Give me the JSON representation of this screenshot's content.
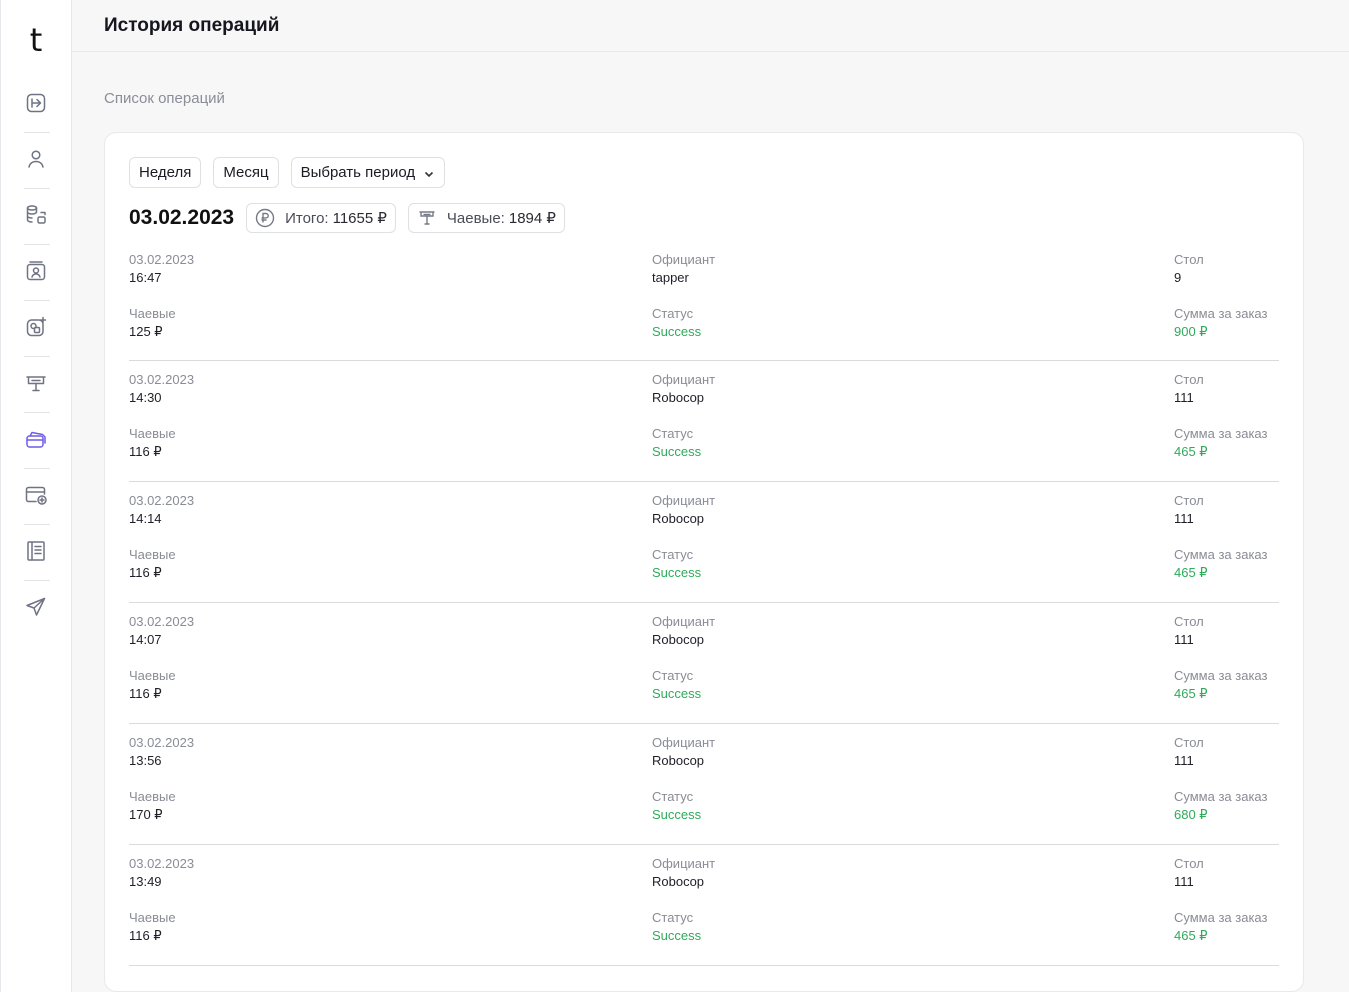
{
  "app": {
    "logo": "t"
  },
  "sidebar": {
    "items": [
      {
        "icon": "login-icon",
        "active": false
      },
      {
        "icon": "user-icon",
        "active": false
      },
      {
        "icon": "database-icon",
        "active": false
      },
      {
        "icon": "profile-card-icon",
        "active": false
      },
      {
        "icon": "widgets-icon",
        "active": false
      },
      {
        "icon": "presentation-icon",
        "active": false
      },
      {
        "icon": "cards-icon",
        "active": true
      },
      {
        "icon": "card-add-icon",
        "active": false
      },
      {
        "icon": "notebook-icon",
        "active": false
      },
      {
        "icon": "send-icon",
        "active": false
      }
    ]
  },
  "header": {
    "title": "История операций"
  },
  "main": {
    "section_label": "Список операций",
    "filters": {
      "week": "Неделя",
      "month": "Месяц",
      "period": "Выбрать период"
    },
    "summary": {
      "date": "03.02.2023",
      "total_label": "Итого:",
      "total_value": "11655 ₽",
      "tips_label": "Чаевые:",
      "tips_value": "1894 ₽"
    },
    "labels": {
      "waiter": "Официант",
      "table": "Стол",
      "tips": "Чаевые",
      "status": "Статус",
      "order_sum": "Сумма за заказ"
    },
    "operations": [
      {
        "date": "03.02.2023",
        "time": "16:47",
        "waiter": "tapper",
        "table": "9",
        "tips": "125 ₽",
        "status": "Success",
        "sum": "900 ₽"
      },
      {
        "date": "03.02.2023",
        "time": "14:30",
        "waiter": "Robocop",
        "table": "111",
        "tips": "116 ₽",
        "status": "Success",
        "sum": "465 ₽"
      },
      {
        "date": "03.02.2023",
        "time": "14:14",
        "waiter": "Robocop",
        "table": "111",
        "tips": "116 ₽",
        "status": "Success",
        "sum": "465 ₽"
      },
      {
        "date": "03.02.2023",
        "time": "14:07",
        "waiter": "Robocop",
        "table": "111",
        "tips": "116 ₽",
        "status": "Success",
        "sum": "465 ₽"
      },
      {
        "date": "03.02.2023",
        "time": "13:56",
        "waiter": "Robocop",
        "table": "111",
        "tips": "170 ₽",
        "status": "Success",
        "sum": "680 ₽"
      },
      {
        "date": "03.02.2023",
        "time": "13:49",
        "waiter": "Robocop",
        "table": "111",
        "tips": "116 ₽",
        "status": "Success",
        "sum": "465 ₽"
      }
    ]
  },
  "colors": {
    "accent": "#6f5ce8",
    "success": "#2fab5a",
    "muted": "#8a8c96"
  }
}
